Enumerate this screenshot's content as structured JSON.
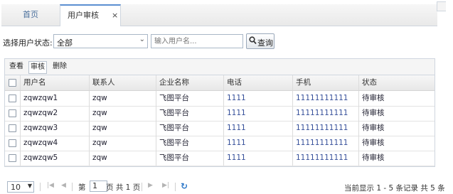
{
  "tabs": {
    "home_label": "首页",
    "review_label": "用户审核",
    "close_glyph": "×"
  },
  "filter": {
    "status_label": "选择用户状态:",
    "status_value": "全部",
    "username_placeholder": "输入用户名...",
    "query_label": "查询"
  },
  "toolbar": {
    "view_label": "查看",
    "audit_label": "审核",
    "delete_label": "删除"
  },
  "table": {
    "columns": [
      "用户名",
      "联系人",
      "企业名称",
      "电话",
      "手机",
      "状态"
    ],
    "rows": [
      [
        "zqwzqw1",
        "zqw",
        "飞图平台",
        "1111",
        "11111111111",
        "待审核"
      ],
      [
        "zqwzqw2",
        "zqw",
        "飞图平台",
        "1111",
        "11111111111",
        "待审核"
      ],
      [
        "zqwzqw3",
        "zqw",
        "飞图平台",
        "1111",
        "11111111111",
        "待审核"
      ],
      [
        "zqwzqw4",
        "zqw",
        "飞图平台",
        "1111",
        "11111111111",
        "待审核"
      ],
      [
        "zqwzqw5",
        "zqw",
        "飞图平台",
        "1111",
        "11111111111",
        "待审核"
      ]
    ]
  },
  "pager": {
    "page_size": "10",
    "page_prefix": "第",
    "page_number": "1",
    "page_suffix": "页 共 1 页",
    "info": "当前显示 1 - 5 条记录 共 5 条"
  },
  "colors": {
    "accent": "#5b8fd1",
    "link": "#36509a",
    "refresh": "#2d78c9"
  }
}
